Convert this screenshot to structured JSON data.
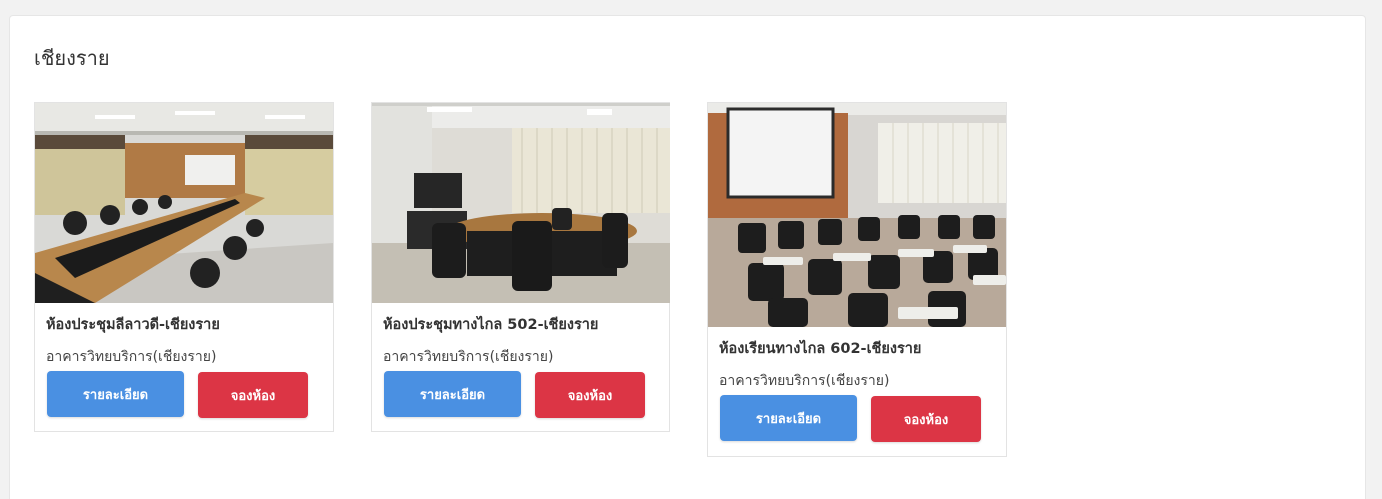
{
  "section": {
    "title": "เชียงราย"
  },
  "colors": {
    "detail_button": "#4a90e2",
    "book_button": "#dc3545"
  },
  "rooms": [
    {
      "name": "ห้องประชุมลีลาวดี-เชียงราย",
      "building": "อาคารวิทยบริการ(เชียงราย)",
      "detail_label": "รายละเอียด",
      "book_label": "จองห้อง",
      "photo": "meeting-room-long-table"
    },
    {
      "name": "ห้องประชุมทางไกล 502-เชียงราย",
      "building": "อาคารวิทยบริการ(เชียงราย)",
      "detail_label": "รายละเอียด",
      "book_label": "จองห้อง",
      "photo": "conference-room-oval-table"
    },
    {
      "name": "ห้องเรียนทางไกล 602-เชียงราย",
      "building": "อาคารวิทยบริการ(เชียงราย)",
      "detail_label": "รายละเอียด",
      "book_label": "จองห้อง",
      "photo": "classroom-projector-desks"
    }
  ]
}
